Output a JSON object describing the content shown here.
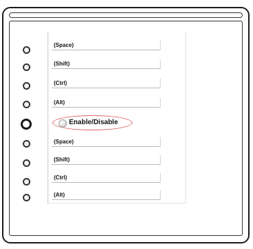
{
  "rows": [
    {
      "label": "(Space)"
    },
    {
      "label": "(Shift)"
    },
    {
      "label": "(Ctrl)"
    },
    {
      "label": "(Alt)"
    },
    {
      "label": "Enable/Disable",
      "highlight": true
    },
    {
      "label": "(Space)"
    },
    {
      "label": "(Shift)"
    },
    {
      "label": "(Ctrl)"
    },
    {
      "label": "(Alt)"
    }
  ]
}
